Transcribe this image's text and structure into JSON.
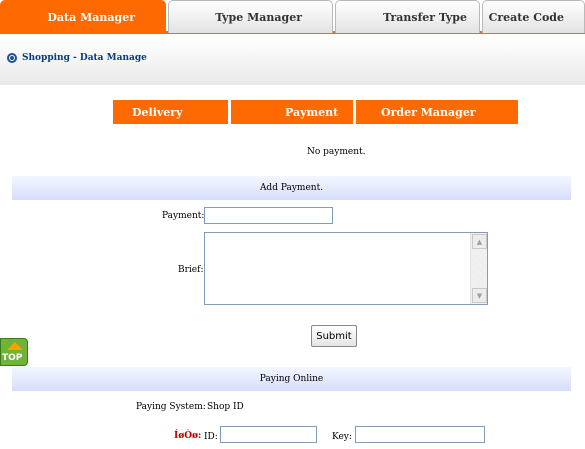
{
  "tabs": [
    {
      "label": "Data Manager",
      "active": true
    },
    {
      "label": "Type Manager",
      "active": false
    },
    {
      "label": "Transfer Type",
      "active": false
    },
    {
      "label": "Create Code",
      "active": false
    }
  ],
  "breadcrumb": "Shopping - Data Manage",
  "subtabs": [
    {
      "label": "Delivery"
    },
    {
      "label": "Payment"
    },
    {
      "label": "Order Manager"
    }
  ],
  "message": "No payment.",
  "add_payment": {
    "title": "Add Payment.",
    "payment_label": "Payment:",
    "payment_value": "",
    "brief_label": "Brief:",
    "brief_value": "",
    "submit_label": "Submit"
  },
  "paying_online": {
    "title": "Paying Online",
    "system_label": "Paying System:",
    "system_value": "Shop ID",
    "garbled_label": "ÍøÒø:",
    "id_label": "ID:",
    "id_value": "",
    "key_label": "Key:",
    "key_value": ""
  },
  "top_button": {
    "label": "TOP"
  },
  "colors": {
    "accent": "#ff6a00",
    "link": "#0a3b85",
    "section_bar": "#d6defa"
  }
}
